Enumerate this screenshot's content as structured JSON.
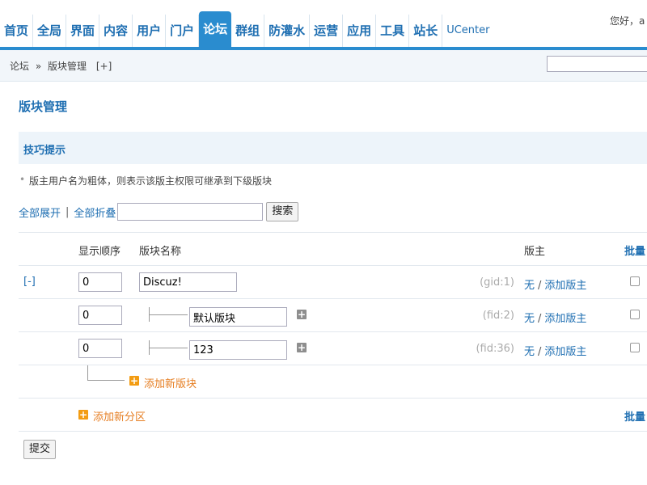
{
  "nav": {
    "items": [
      "首页",
      "全局",
      "界面",
      "内容",
      "用户",
      "门户",
      "论坛",
      "群组",
      "防灌水",
      "运营",
      "应用",
      "工具",
      "站长",
      "UCenter"
    ],
    "active_index": 6,
    "greeting": "您好，a"
  },
  "breadcrumb": {
    "items": [
      "论坛",
      "版块管理"
    ],
    "separator": "»",
    "add_label": "[+]"
  },
  "page": {
    "title": "版块管理",
    "tips_title": "技巧提示",
    "tip_text": "版主用户名为粗体，则表示该版主权限可继承到下级版块"
  },
  "toolbar": {
    "expand_all": "全部展开",
    "divider": "|",
    "collapse_all": "全部折叠",
    "search_value": "",
    "search_button": "搜索"
  },
  "table": {
    "headers": {
      "order": "显示顺序",
      "name": "版块名称",
      "moderators": "版主",
      "batch": "批量"
    },
    "collapse_label": "[-]",
    "rows": [
      {
        "order": "0",
        "name": "Discuz!",
        "id_label": "(gid:1)",
        "mod_none": "无",
        "mod_sep": "/",
        "mod_add": "添加版主"
      },
      {
        "order": "0",
        "name": "默认版块",
        "id_label": "(fid:2)",
        "mod_none": "无",
        "mod_sep": "/",
        "mod_add": "添加版主"
      },
      {
        "order": "0",
        "name": "123",
        "id_label": "(fid:36)",
        "mod_none": "无",
        "mod_sep": "/",
        "mod_add": "添加版主"
      }
    ],
    "add_forum": "添加新版块",
    "add_category": "添加新分区",
    "batch_bottom": "批量"
  },
  "submit": {
    "label": "提交"
  },
  "colors": {
    "primary_blue": "#2a8ccf",
    "link_blue": "#1f6fb2",
    "orange": "#e67e22",
    "plus_orange": "#f39c12"
  }
}
